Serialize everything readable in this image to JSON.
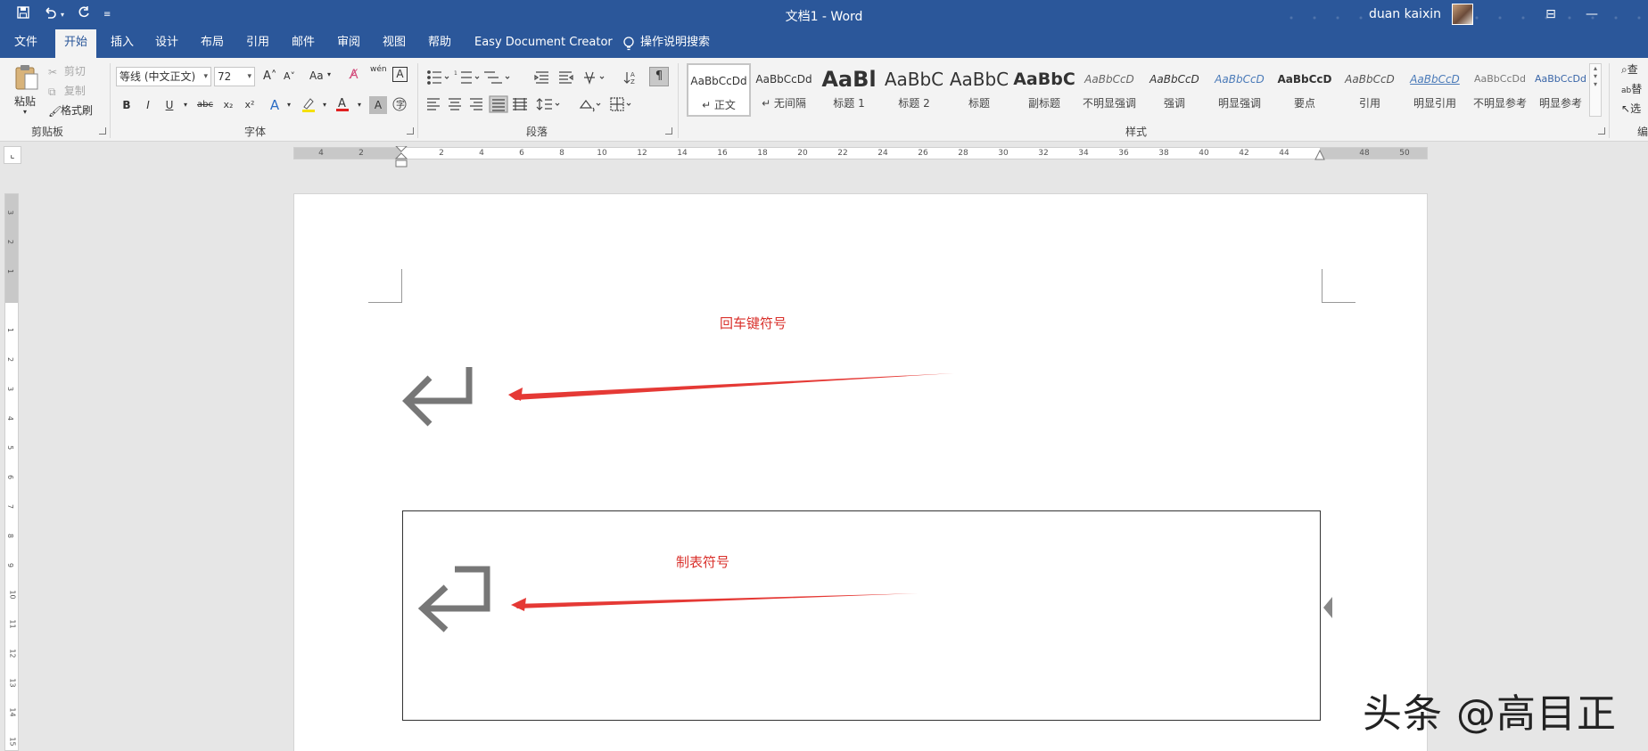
{
  "title_bar": {
    "title": "文档1  -  Word",
    "user": "duan kaixin",
    "qat": {
      "save_icon": "save-icon",
      "undo_icon": "undo-icon",
      "redo_icon": "redo-icon",
      "customize_icon": "customize-qat-icon"
    },
    "window_buttons": {
      "ribbon_display": "ribbon-display-options-icon",
      "minimize": "minimize-icon"
    }
  },
  "tabs": [
    "文件",
    "开始",
    "插入",
    "设计",
    "布局",
    "引用",
    "邮件",
    "审阅",
    "视图",
    "帮助",
    "Easy Document Creator",
    "操作说明搜索"
  ],
  "active_tab": "开始",
  "ribbon": {
    "clipboard": {
      "label": "剪贴板",
      "paste": "粘贴",
      "cut": "剪切",
      "copy": "复制",
      "format_painter": "格式刷"
    },
    "font": {
      "label": "字体",
      "font_name": "等线 (中文正文)",
      "font_size": "72",
      "grow": "A˄",
      "shrink": "A˅",
      "change_case": "Aa",
      "bold": "B",
      "italic": "I",
      "underline": "U",
      "strike": "abc",
      "subscript": "x₂",
      "superscript": "x²",
      "phonetic": "wén",
      "char_border": "A"
    },
    "paragraph": {
      "label": "段落"
    },
    "styles": {
      "label": "样式",
      "items": [
        {
          "preview": "AaBbCcDd",
          "name": "↵ 正文"
        },
        {
          "preview": "AaBbCcDd",
          "name": "↵ 无间隔"
        },
        {
          "preview": "AaBl",
          "name": "标题 1"
        },
        {
          "preview": "AaBbC",
          "name": "标题 2"
        },
        {
          "preview": "AaBbC",
          "name": "标题"
        },
        {
          "preview": "AaBbC",
          "name": "副标题"
        },
        {
          "preview": "AaBbCcD",
          "name": "不明显强调"
        },
        {
          "preview": "AaBbCcD",
          "name": "强调"
        },
        {
          "preview": "AaBbCcD",
          "name": "明显强调"
        },
        {
          "preview": "AaBbCcD",
          "name": "要点"
        },
        {
          "preview": "AaBbCcD",
          "name": "引用"
        },
        {
          "preview": "AaBbCcD",
          "name": "明显引用"
        },
        {
          "preview": "AaBbCcDd",
          "name": "不明显参考"
        },
        {
          "preview": "AaBbCcDd",
          "name": "明显参考"
        }
      ]
    },
    "editing": {
      "find": "查",
      "replace": "替",
      "select": "选",
      "label": "编"
    }
  },
  "ruler": {
    "h_ticks": [
      "4",
      "2",
      "2",
      "4",
      "6",
      "8",
      "10",
      "12",
      "14",
      "16",
      "18",
      "20",
      "22",
      "24",
      "26",
      "28",
      "30",
      "32",
      "34",
      "36",
      "38",
      "40",
      "42",
      "44",
      "48",
      "50"
    ],
    "v_ticks": [
      "3",
      "2",
      "1",
      "1",
      "2",
      "3",
      "4",
      "5",
      "6",
      "7",
      "8",
      "9",
      "10",
      "11",
      "12",
      "13",
      "14",
      "15"
    ]
  },
  "document": {
    "annotation_1": "回车键符号",
    "annotation_2": "制表符号"
  },
  "watermark": "头条 @高目正",
  "colors": {
    "title_bar": "#2b579a",
    "annotation": "#d9302b",
    "arrow": "#e53935",
    "glyph": "#777777"
  }
}
